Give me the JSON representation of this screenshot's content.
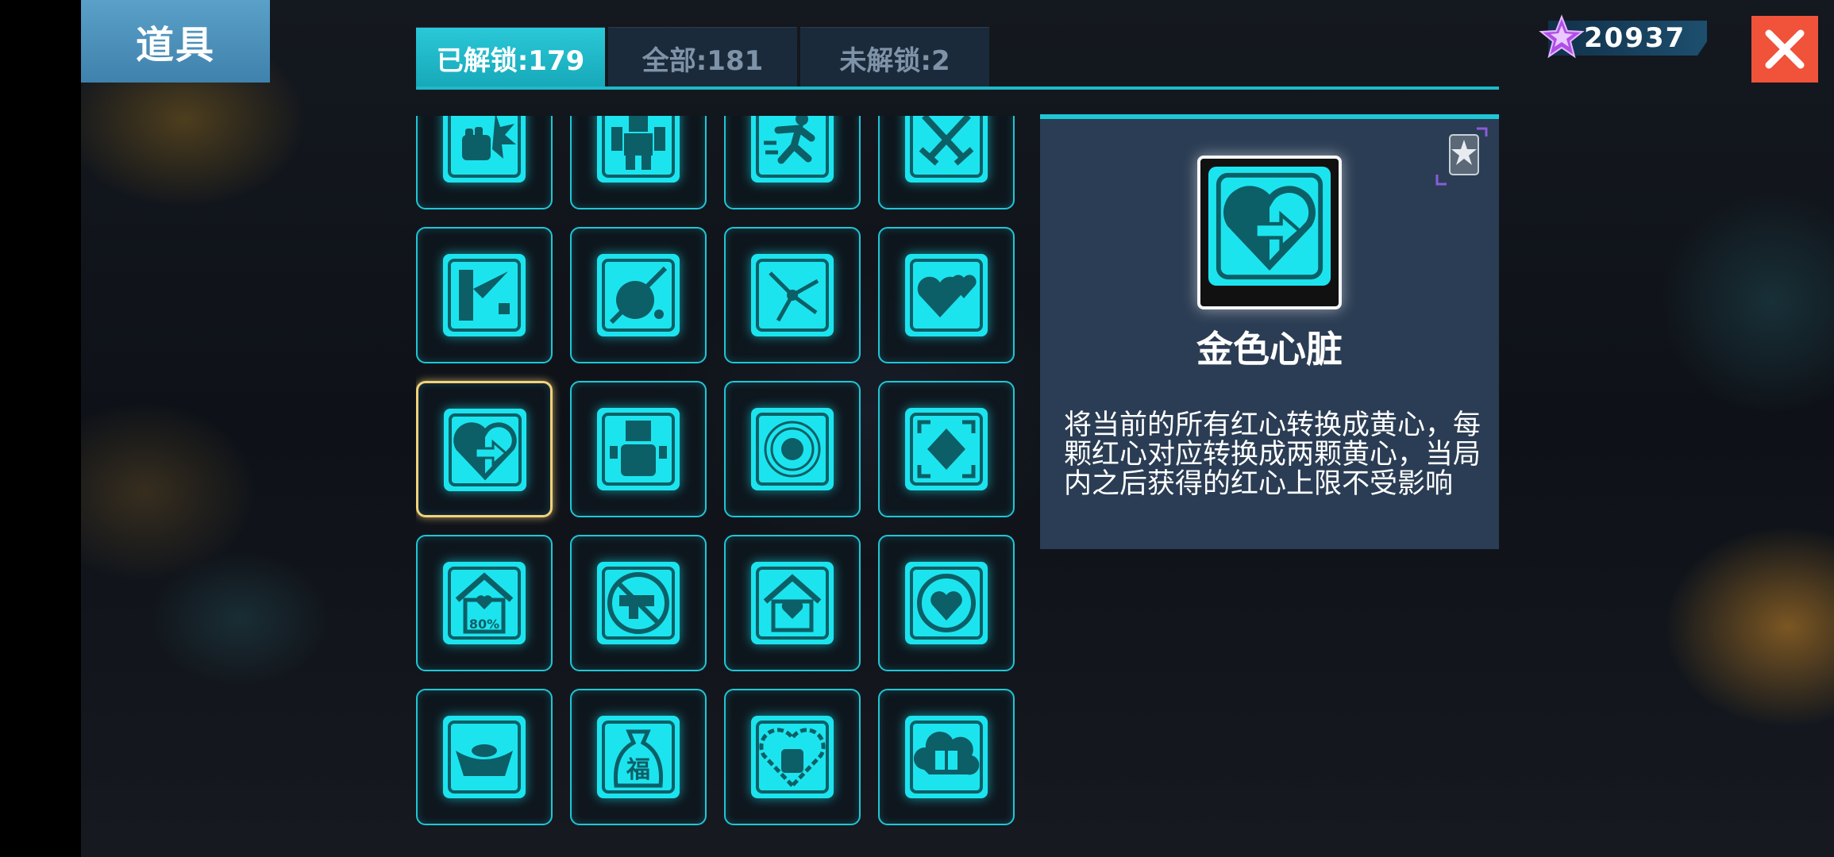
{
  "header": {
    "title": "道具"
  },
  "tabs": [
    {
      "label": "已解锁:179",
      "active": true
    },
    {
      "label": "全部:181",
      "active": false
    },
    {
      "label": "未解锁:2",
      "active": false
    }
  ],
  "currency": {
    "icon": "purple-star-icon",
    "value": "20937"
  },
  "close": {
    "icon": "close-icon"
  },
  "grid": {
    "items": [
      {
        "icon": "fist-burst-icon"
      },
      {
        "icon": "muscle-robot-icon"
      },
      {
        "icon": "running-man-icon"
      },
      {
        "icon": "crossed-swords-icon"
      },
      {
        "icon": "knockback-icon"
      },
      {
        "icon": "no-bomb-icon"
      },
      {
        "icon": "scatter-arrows-icon"
      },
      {
        "icon": "hearts-icon"
      },
      {
        "icon": "golden-heart-icon",
        "selected": true
      },
      {
        "icon": "robot-fist-icon"
      },
      {
        "icon": "target-rings-icon"
      },
      {
        "icon": "expand-arrows-icon"
      },
      {
        "icon": "house-heart-80-icon",
        "text": "80%"
      },
      {
        "icon": "no-gun-icon"
      },
      {
        "icon": "house-heart-icon"
      },
      {
        "icon": "heart-medal-icon"
      },
      {
        "icon": "gold-ingot-icon"
      },
      {
        "icon": "fortune-bag-icon",
        "text": "福"
      },
      {
        "icon": "heart-fist-icon"
      },
      {
        "icon": "gift-cloud-icon"
      }
    ]
  },
  "detail": {
    "icon": "golden-heart-icon",
    "rarity_icon": "silver-star-badge-icon",
    "name": "金色心脏",
    "description": "将当前的所有红心转换成黄心，每颗红心对应转换成两颗黄心，当局内之后获得的红心上限不受影响"
  },
  "colors": {
    "accent": "#1fc6d6",
    "icon_fill": "#1ce4ef",
    "selected_border": "#f4d27a",
    "close_bg": "#f0523a"
  }
}
